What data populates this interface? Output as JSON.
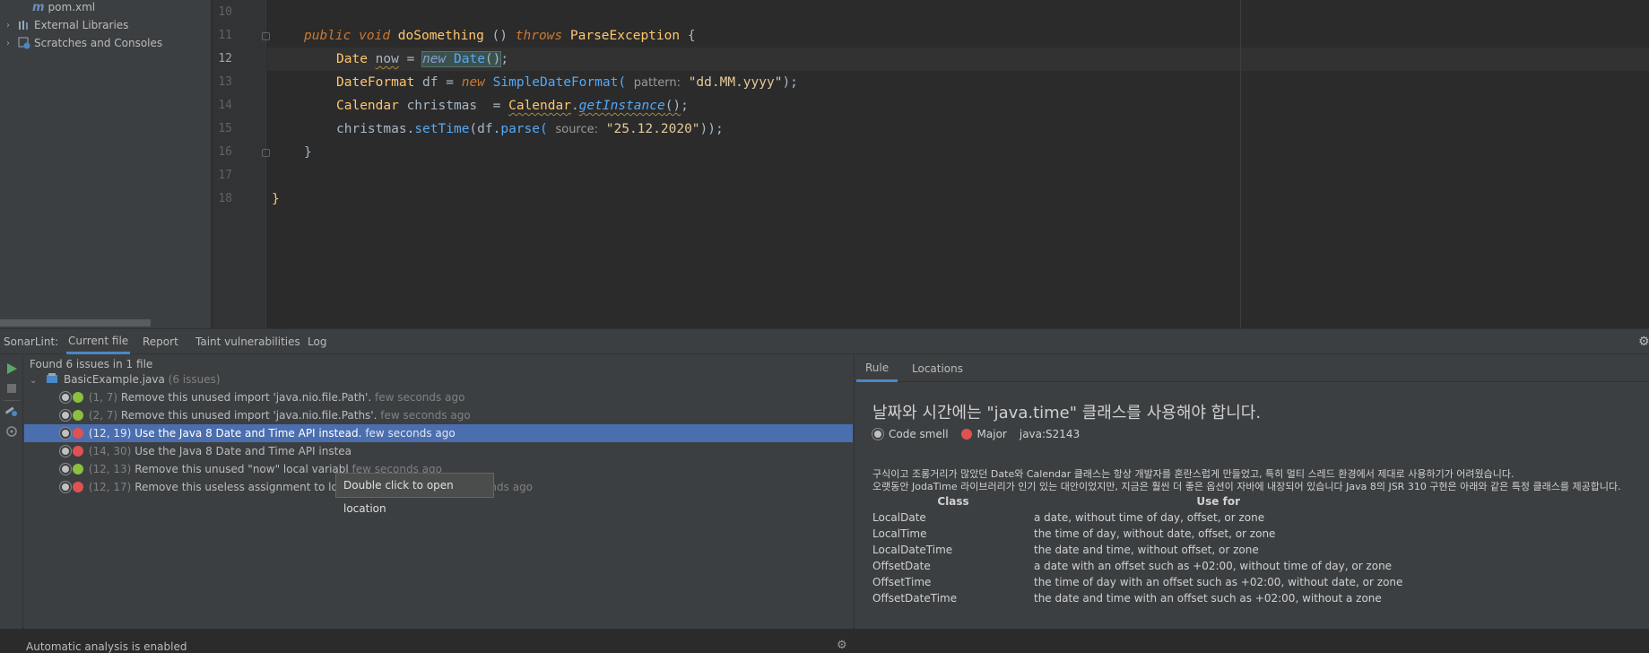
{
  "project_tree": [
    {
      "label": "pom.xml",
      "icon": "maven-file-icon"
    },
    {
      "label": "External Libraries",
      "icon": "libraries-icon"
    },
    {
      "label": "Scratches and Consoles",
      "icon": "scratches-icon"
    }
  ],
  "editor": {
    "line_numbers": [
      "10",
      "11",
      "12",
      "13",
      "14",
      "15",
      "16",
      "17",
      "18"
    ],
    "lines": {
      "l11": {
        "kw1": "public",
        "kw2": "void",
        "name": "doSomething",
        "paren": "()",
        "kw3": "throws",
        "exc": "ParseException",
        "brace": "{"
      },
      "l12": {
        "type": "Date",
        "var": "now",
        "eq": "=",
        "kw": "new",
        "cls": "Date",
        "call": "()",
        "semi": ";"
      },
      "l13": {
        "type": "DateFormat",
        "var": "df",
        "eq": "=",
        "kw": "new",
        "cls": "SimpleDateFormat(",
        "hint": "pattern:",
        "str": "\"dd.MM.yyyy\"",
        "end": ");"
      },
      "l14": {
        "type": "Calendar",
        "var": "christmas",
        "eq": "=",
        "cls": "Calendar",
        "dot": ".",
        "mth": "getInstance",
        "call": "()",
        "semi": ";"
      },
      "l15": {
        "obj": "christmas.",
        "mth": "setTime",
        "p1": "(df.",
        "mth2": "parse(",
        "hint": "source:",
        "str": "\"25.12.2020\"",
        "end": "));"
      },
      "l16": {
        "brace": "}"
      },
      "l18": {
        "brace": "}"
      }
    }
  },
  "sonarlint": {
    "label": "SonarLint:",
    "tabs": [
      "Current file",
      "Report",
      "Taint vulnerabilities",
      "Log"
    ],
    "active_tab": "Current file",
    "summary": "Found 6 issues in 1 file",
    "file": {
      "name": "BasicExample.java",
      "count": "(6 issues)"
    },
    "issues": [
      {
        "loc": "(1, 7)",
        "text": "Remove this unused import 'java.nio.file.Path'.",
        "time": "few seconds ago",
        "severity": "down"
      },
      {
        "loc": "(2, 7)",
        "text": "Remove this unused import 'java.nio.file.Paths'.",
        "time": "few seconds ago",
        "severity": "down"
      },
      {
        "loc": "(12, 19)",
        "text": "Use the Java 8 Date and Time API instead.",
        "time": "few seconds ago",
        "severity": "up"
      },
      {
        "loc": "(14, 30)",
        "text": "Use the Java 8 Date and Time API instea",
        "time": "",
        "severity": "up"
      },
      {
        "loc": "(12, 13)",
        "text": "Remove this unused \"now\" local variabl",
        "time": "few seconds ago",
        "severity": "down"
      },
      {
        "loc": "(12, 17)",
        "text": "Remove this useless assignment to local variable \"now\".",
        "time": "few seconds ago",
        "severity": "up"
      }
    ],
    "tooltip": "Double click to open location",
    "status": "Automatic analysis is enabled"
  },
  "rule": {
    "tabs": [
      "Rule",
      "Locations"
    ],
    "active_tab": "Rule",
    "title": "날짜와 시간에는 \"java.time\" 클래스를 사용해야 합니다.",
    "type": "Code smell",
    "severity": "Major",
    "key": "java:S2143",
    "desc1": "구식이고 조롱거리가 많았던 Date와 Calendar 클래스는 항상 개발자를 혼란스럽게 만들었고, 특히 멀티 스레드 환경에서 제대로 사용하기가  어려웠습니다.",
    "desc2": "오랫동안 JodaTime 라이브러리가 인기 있는 대안이었지만, 지금은 훨씬 더 좋은 옵션이 자바에 내장되어 있습니다 Java 8의 JSR 310 구현은 아래와 같은 특정 클래스를 제공합니다.",
    "table": {
      "headers": [
        "Class",
        "Use for"
      ],
      "rows": [
        [
          "LocalDate",
          "a date, without time of day, offset, or zone"
        ],
        [
          "LocalTime",
          "the time of day, without date, offset, or zone"
        ],
        [
          "LocalDateTime",
          "the date and time, without offset, or zone"
        ],
        [
          "OffsetDate",
          "a date with an offset such as +02:00, without time of day, or zone"
        ],
        [
          "OffsetTime",
          "the time of day with an offset such as +02:00, without date, or zone"
        ],
        [
          "OffsetDateTime",
          "the date and time with an offset such as +02:00, without a zone"
        ]
      ]
    }
  },
  "colors": {
    "accent": "#4a88c7",
    "selection": "#4b6eaf",
    "major": "#e05252",
    "minor": "#8cbf3f"
  }
}
